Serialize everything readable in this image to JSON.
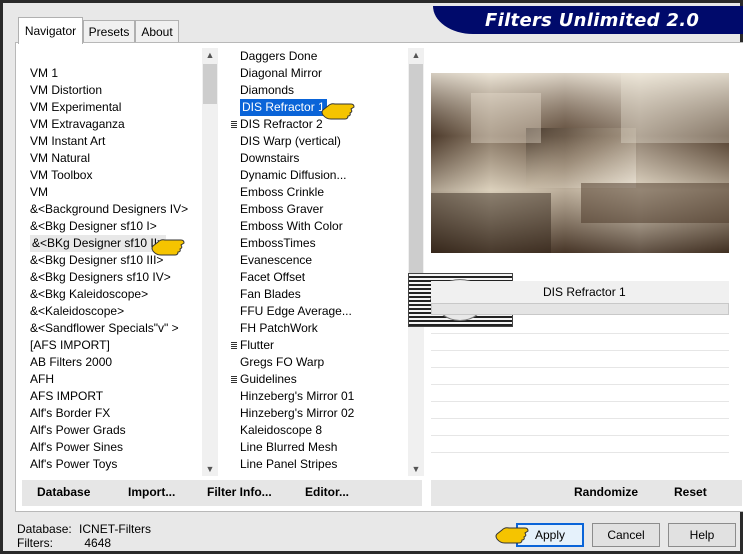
{
  "app": {
    "title": "Filters Unlimited 2.0"
  },
  "tabs": [
    {
      "label": "Navigator"
    },
    {
      "label": "Presets"
    },
    {
      "label": "About"
    }
  ],
  "categories": [
    "VM 1",
    "VM Distortion",
    "VM Experimental",
    "VM Extravaganza",
    "VM Instant Art",
    "VM Natural",
    "VM Toolbox",
    "VM",
    "&<Background Designers IV>",
    "&<Bkg Designer sf10 I>",
    "&<BKg Designer sf10 II>",
    "&<Bkg Designer sf10 III>",
    "&<Bkg Designers sf10 IV>",
    "&<Bkg Kaleidoscope>",
    "&<Kaleidoscope>",
    "&<Sandflower Specials\"v\" >",
    "[AFS IMPORT]",
    "AB Filters 2000",
    "AFH",
    "AFS IMPORT",
    "Alf's Border FX",
    "Alf's Power Grads",
    "Alf's Power Sines",
    "Alf's Power Toys"
  ],
  "categories_highlighted_index": 10,
  "filters": [
    {
      "label": "Daggers Done",
      "marker": false
    },
    {
      "label": "Diagonal Mirror",
      "marker": false
    },
    {
      "label": "Diamonds",
      "marker": false
    },
    {
      "label": "DIS Refractor 1",
      "marker": false
    },
    {
      "label": "DIS Refractor 2",
      "marker": true
    },
    {
      "label": "DIS Warp (vertical)",
      "marker": false
    },
    {
      "label": "Downstairs",
      "marker": false
    },
    {
      "label": "Dynamic Diffusion...",
      "marker": false
    },
    {
      "label": "Emboss Crinkle",
      "marker": false
    },
    {
      "label": "Emboss Graver",
      "marker": false
    },
    {
      "label": "Emboss With Color",
      "marker": false
    },
    {
      "label": "EmbossTimes",
      "marker": false
    },
    {
      "label": "Evanescence",
      "marker": false
    },
    {
      "label": "Facet Offset",
      "marker": false
    },
    {
      "label": "Fan Blades",
      "marker": false
    },
    {
      "label": "FFU Edge Average...",
      "marker": false
    },
    {
      "label": "FH PatchWork",
      "marker": false
    },
    {
      "label": "Flutter",
      "marker": true
    },
    {
      "label": "Gregs FO Warp",
      "marker": false
    },
    {
      "label": "Guidelines",
      "marker": true
    },
    {
      "label": "Hinzeberg's Mirror 01",
      "marker": false
    },
    {
      "label": "Hinzeberg's Mirror 02",
      "marker": false
    },
    {
      "label": "Kaleidoscope 8",
      "marker": false
    },
    {
      "label": "Line Blurred Mesh",
      "marker": false
    },
    {
      "label": "Line Panel Stripes",
      "marker": false
    }
  ],
  "filters_selected_index": 3,
  "selected_filter": "DIS Refractor 1",
  "watermark": "claudia",
  "left_toolbar": {
    "database": "Database",
    "import": "Import...",
    "filter_info": "Filter Info...",
    "editor": "Editor..."
  },
  "right_toolbar": {
    "randomize": "Randomize",
    "reset": "Reset"
  },
  "status": {
    "database_label": "Database:",
    "database_value": "ICNET-Filters",
    "filters_label": "Filters:",
    "filters_value": "4648"
  },
  "buttons": {
    "apply": "Apply",
    "cancel": "Cancel",
    "help": "Help"
  },
  "colors": {
    "title_bg": "#000a6b",
    "selection": "#0a64d8",
    "hand": "#f5c400"
  }
}
